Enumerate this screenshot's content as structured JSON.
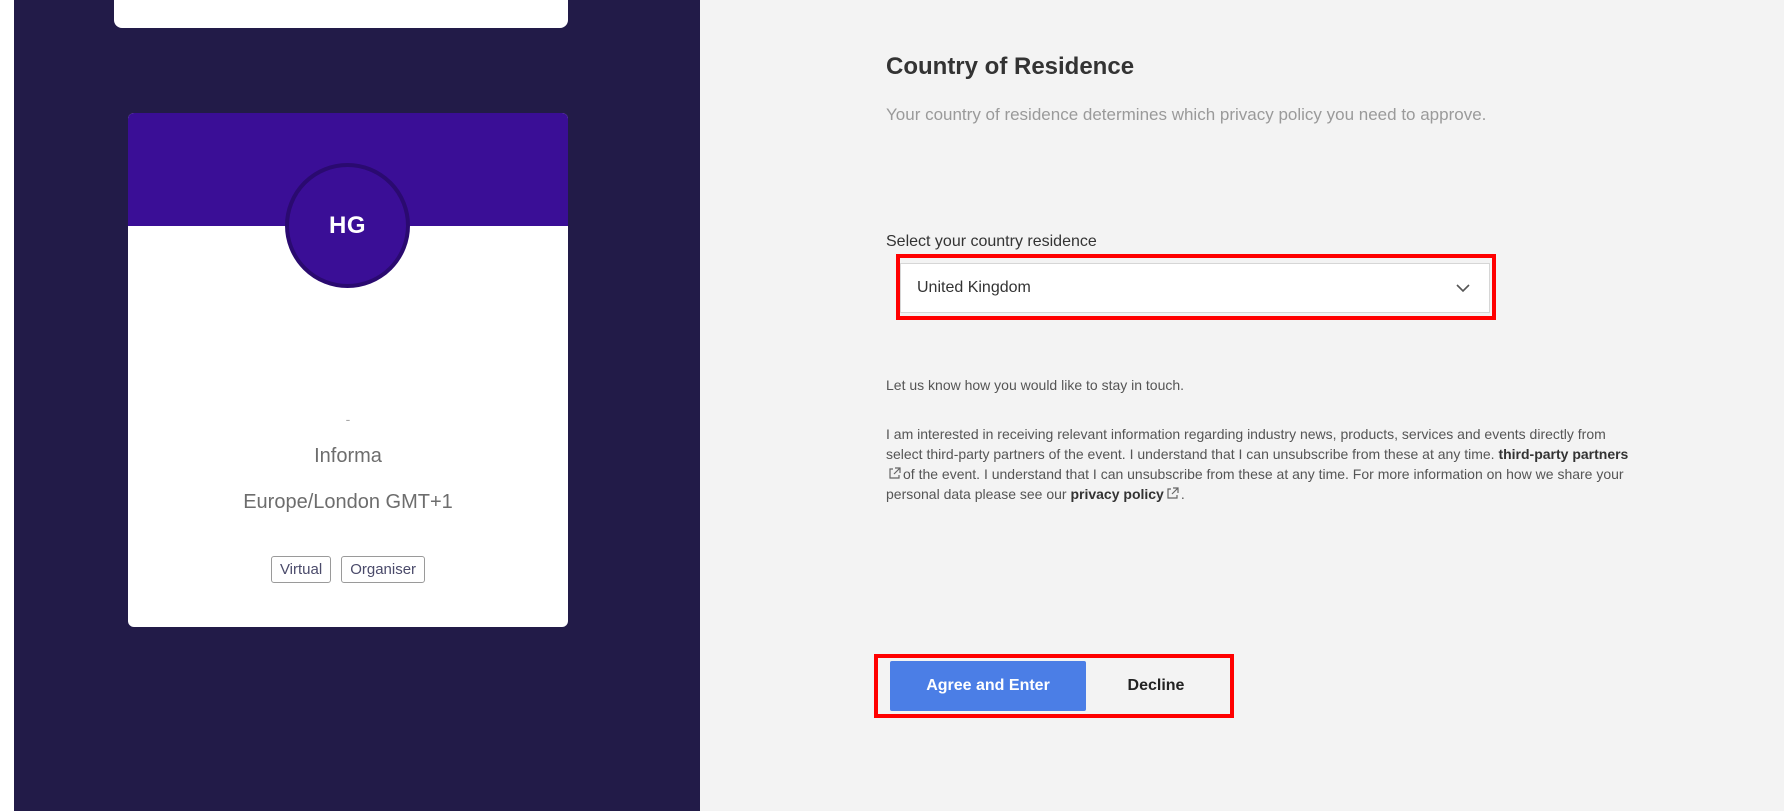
{
  "colors": {
    "sidebar_bg": "#221b48",
    "card_header": "#3a0e96",
    "content_bg": "#f3f3f3",
    "primary_button": "#4b7ee6",
    "highlight": "#ff0000"
  },
  "profile_card": {
    "initials": "HG",
    "name_placeholder": "-",
    "company": "Informa",
    "timezone": "Europe/London GMT+1",
    "badges": [
      "Virtual",
      "Organiser"
    ]
  },
  "residence": {
    "title": "Country of Residence",
    "description": "Your country of residence determines which privacy policy you need to approve.",
    "select_label": "Select your country residence",
    "selected_country": "United Kingdom",
    "chevron_icon": "chevron-down-icon"
  },
  "contact": {
    "intro": "Let us know how you would like to stay in touch.",
    "consent_part1": "I am interested in receiving relevant information regarding industry news, products, services and events directly from select third-party partners of the event. I understand that I can unsubscribe from these at any time.",
    "third_party_link": "third-party partners",
    "consent_part2": "of the event. I understand that I can unsubscribe from these at any time. For more information on how we share your personal data please see our",
    "privacy_link": "privacy policy",
    "consent_end": ".",
    "external_icon": "external-link-icon"
  },
  "actions": {
    "agree_label": "Agree and Enter",
    "decline_label": "Decline"
  }
}
